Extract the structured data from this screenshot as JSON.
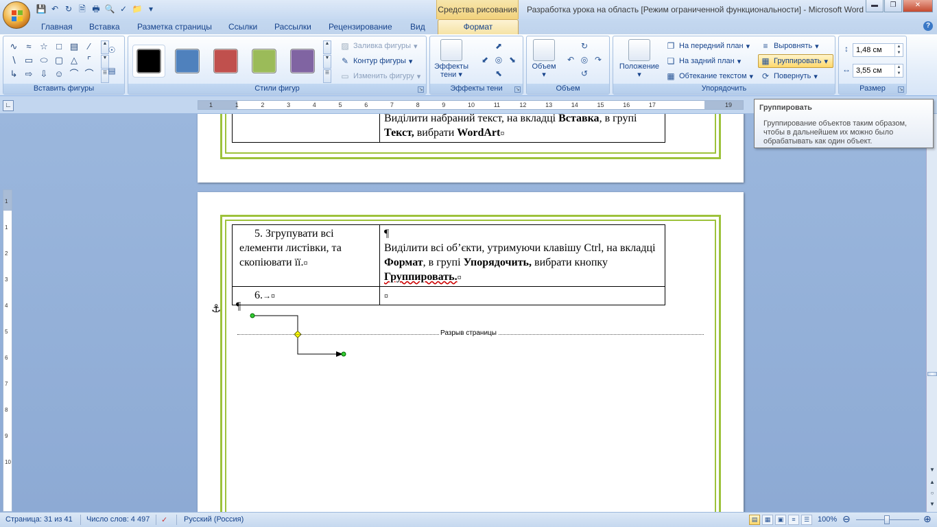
{
  "window": {
    "title": "Разработка урока на область [Режим ограниченной функциональности] - Microsoft Word",
    "context_tab_group": "Средства рисования"
  },
  "tabs": [
    "Главная",
    "Вставка",
    "Разметка страницы",
    "Ссылки",
    "Рассылки",
    "Рецензирование",
    "Вид",
    "Формат"
  ],
  "ribbon": {
    "insert_shapes": {
      "label": "Вставить фигуры"
    },
    "shape_styles": {
      "label": "Стили фигур",
      "fill": "Заливка фигуры",
      "outline": "Контур фигуры",
      "change": "Изменить фигуру",
      "swatches": [
        "#000000",
        "#4f81bd",
        "#c0504d",
        "#9bbb59",
        "#8064a2"
      ]
    },
    "shadow_effects": {
      "label": "Эффекты тени",
      "button": "Эффекты тени"
    },
    "volume": {
      "label": "Объем",
      "button": "Объем"
    },
    "arrange": {
      "label": "Упорядочить",
      "position": "Положение",
      "bring_front": "На передний план",
      "send_back": "На задний план",
      "wrap": "Обтекание текстом",
      "align": "Выровнять",
      "group": "Группировать",
      "rotate": "Повернуть"
    },
    "size": {
      "label": "Размер",
      "height": "1,48 см",
      "width": "3,55 см"
    }
  },
  "ruler": {
    "numbers": [
      "1",
      "1",
      "2",
      "3",
      "4",
      "5",
      "6",
      "7",
      "8",
      "9",
      "10",
      "11",
      "12",
      "13",
      "14",
      "15",
      "16",
      "17",
      "19"
    ]
  },
  "vruler": {
    "numbers": [
      "1",
      "1",
      "2",
      "3",
      "4",
      "5",
      "6",
      "7",
      "8",
      "9",
      "10"
    ]
  },
  "tooltip": {
    "title": "Группировать",
    "body": "Группирование объектов таким образом, чтобы в дальнейшем их можно было обрабатывать как один объект."
  },
  "document": {
    "page1": {
      "cell_text_1": "Виділити набраний текст, на вкладці ",
      "cell_bold_1": "Вставка",
      "cell_text_2": ", в групі ",
      "cell_bold_2": "Текст,",
      "cell_text_3": " вибрати ",
      "cell_bold_3": "WordArt"
    },
    "page2": {
      "row1_left": "5. Згрупувати всі елементи листівки, та скопіювати її.",
      "row1_right_text_1": "Виділити всі об’єкти, утримуючи клавішу Ctrl, на вкладці ",
      "row1_right_bold_1": "Формат",
      "row1_right_text_2": ", в групі ",
      "row1_right_bold_2": "Упорядочить,",
      "row1_right_text_3": " вибрати кнопку ",
      "row1_right_bold_3": "Группировать.",
      "row2_left": "6.",
      "page_break": "Разрыв страницы"
    }
  },
  "statusbar": {
    "page": "Страница: 31 из 41",
    "words": "Число слов: 4 497",
    "language": "Русский (Россия)",
    "zoom": "100%"
  },
  "colors": {
    "page_border": "#9dc23b",
    "accent": "#15428b"
  }
}
